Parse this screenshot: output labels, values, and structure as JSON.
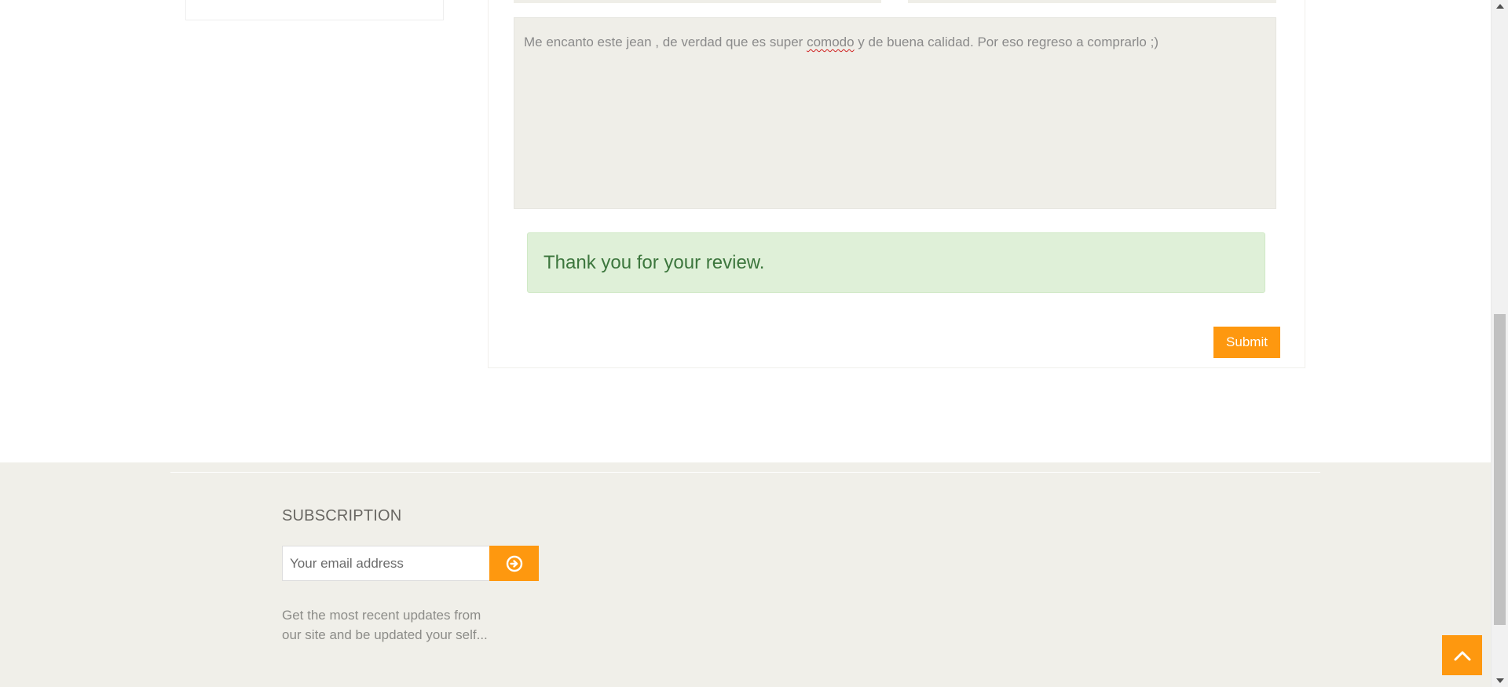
{
  "review": {
    "text_before": "Me encanto este jean , de verdad que es super ",
    "misspelled_word": "comodo",
    "text_after": " y de buena calidad. Por eso regreso a comprarlo ;)",
    "success_message": "Thank you for your review.",
    "submit_label": "Submit"
  },
  "footer": {
    "subscription_title": "SUBSCRIPTION",
    "email_placeholder": "Your email address",
    "subscribe_icon": "arrow-circle-right-icon",
    "description_line1": "Get the most recent updates from",
    "description_line2": "our site and be updated your self..."
  },
  "scroll_up": {
    "icon": "chevron-up-icon"
  },
  "colors": {
    "accent": "#fe980f",
    "success_bg": "#dff0d8",
    "success_text": "#3c763d",
    "footer_bg": "#f0efe9",
    "textarea_bg": "#efeee8"
  }
}
